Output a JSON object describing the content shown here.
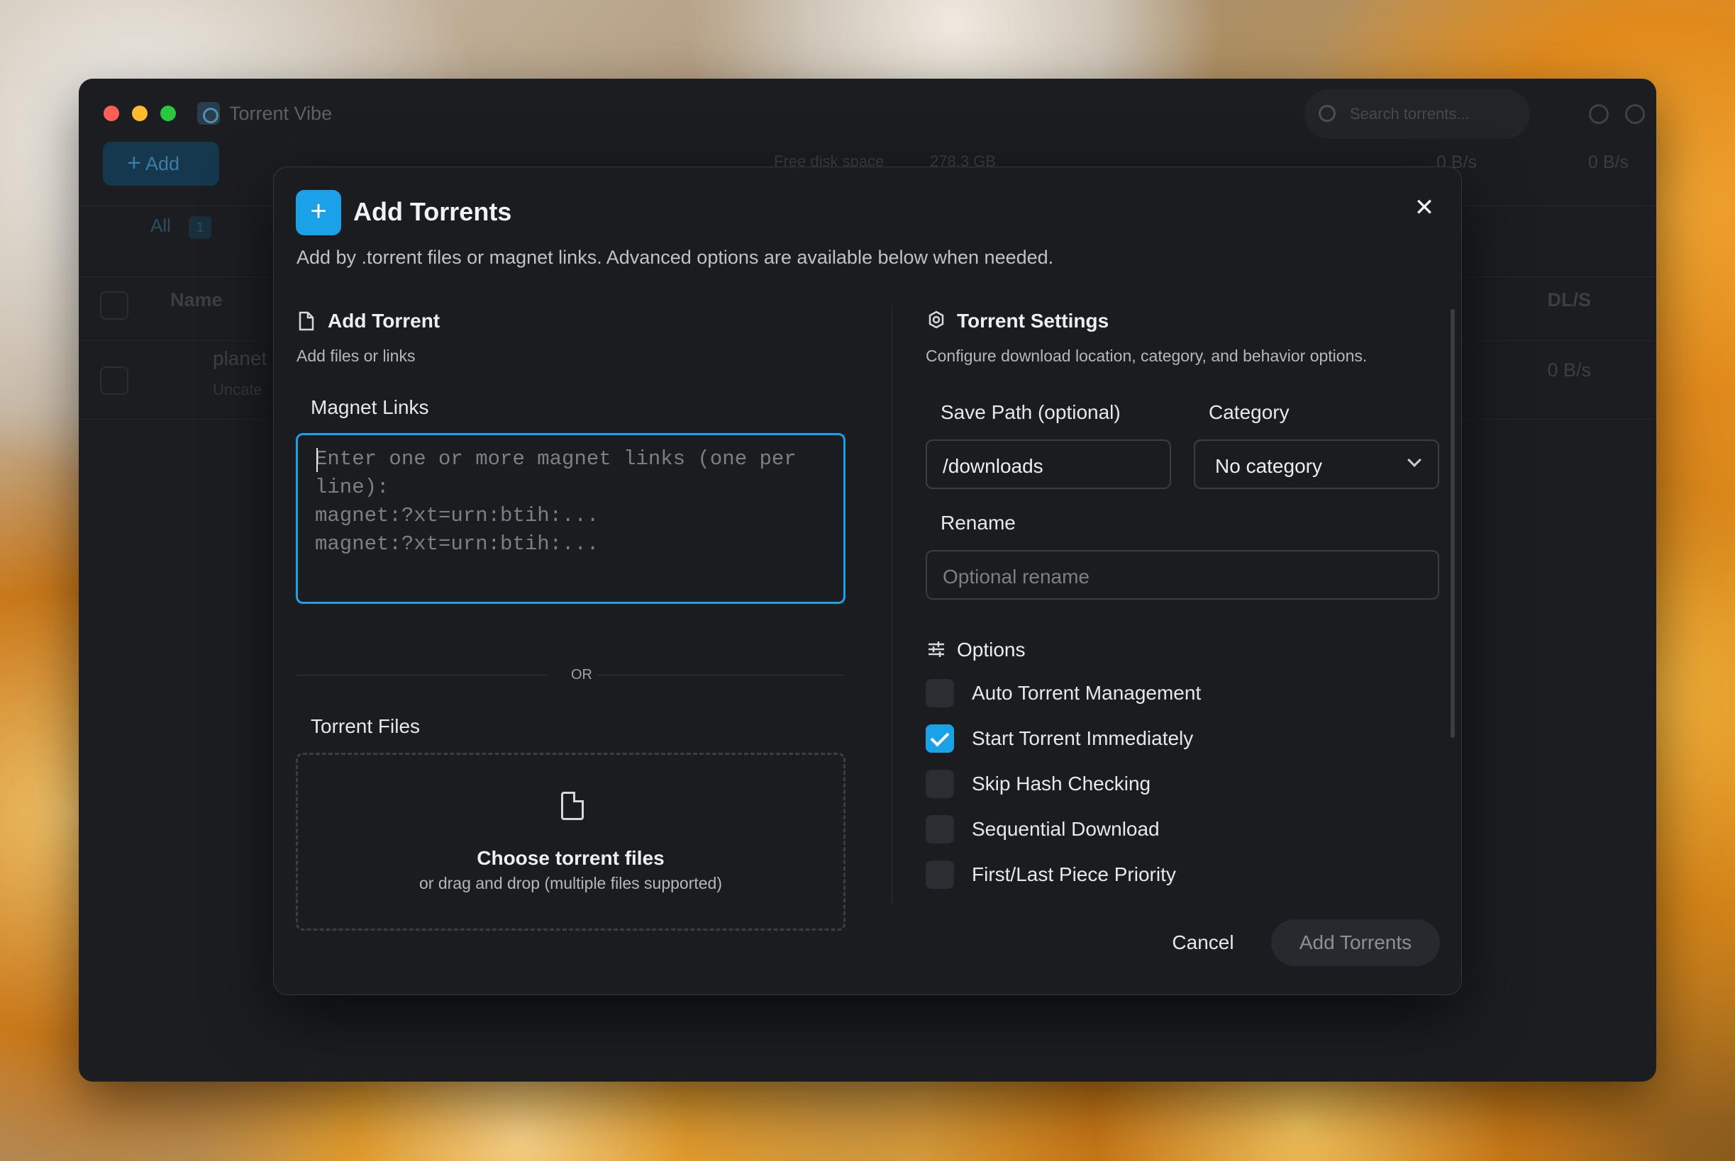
{
  "window": {
    "app_title": "Torrent Vibe",
    "search_placeholder": "Search torrents...",
    "toolbar": {
      "add_label": "Add",
      "free_disk_label": "Free disk space",
      "free_disk_value": "278.3 GB",
      "download_speed": "0 B/s",
      "upload_speed": "0 B/s"
    },
    "filters": {
      "all_label": "All",
      "all_count": "1"
    },
    "table": {
      "columns": {
        "name": "Name",
        "dl": "DL/S"
      },
      "rows": [
        {
          "name": "planet",
          "category": "Uncate",
          "dl": "0 B/s"
        }
      ]
    }
  },
  "dialog": {
    "title": "Add Torrents",
    "description": "Add by .torrent files or magnet links. Advanced options are available below when needed.",
    "left": {
      "section_title": "Add Torrent",
      "section_sub": "Add files or links",
      "magnet_label": "Magnet Links",
      "magnet_placeholder": "Enter one or more magnet links (one per\nline):\nmagnet:?xt=urn:btih:...\nmagnet:?xt=urn:btih:...",
      "or_label": "OR",
      "files_label": "Torrent Files",
      "drop_title": "Choose torrent files",
      "drop_sub": "or drag and drop (multiple files supported)"
    },
    "right": {
      "section_title": "Torrent Settings",
      "section_sub": "Configure download location, category, and behavior options.",
      "save_path_label": "Save Path (optional)",
      "save_path_value": "/downloads",
      "category_label": "Category",
      "category_value": "No category",
      "rename_label": "Rename",
      "rename_placeholder": "Optional rename",
      "options_title": "Options",
      "options": [
        {
          "label": "Auto Torrent Management",
          "checked": false
        },
        {
          "label": "Start Torrent Immediately",
          "checked": true
        },
        {
          "label": "Skip Hash Checking",
          "checked": false
        },
        {
          "label": "Sequential Download",
          "checked": false
        },
        {
          "label": "First/Last Piece Priority",
          "checked": false
        }
      ]
    },
    "buttons": {
      "cancel": "Cancel",
      "submit": "Add Torrents"
    },
    "colors": {
      "accent": "#1ba1e8"
    }
  }
}
